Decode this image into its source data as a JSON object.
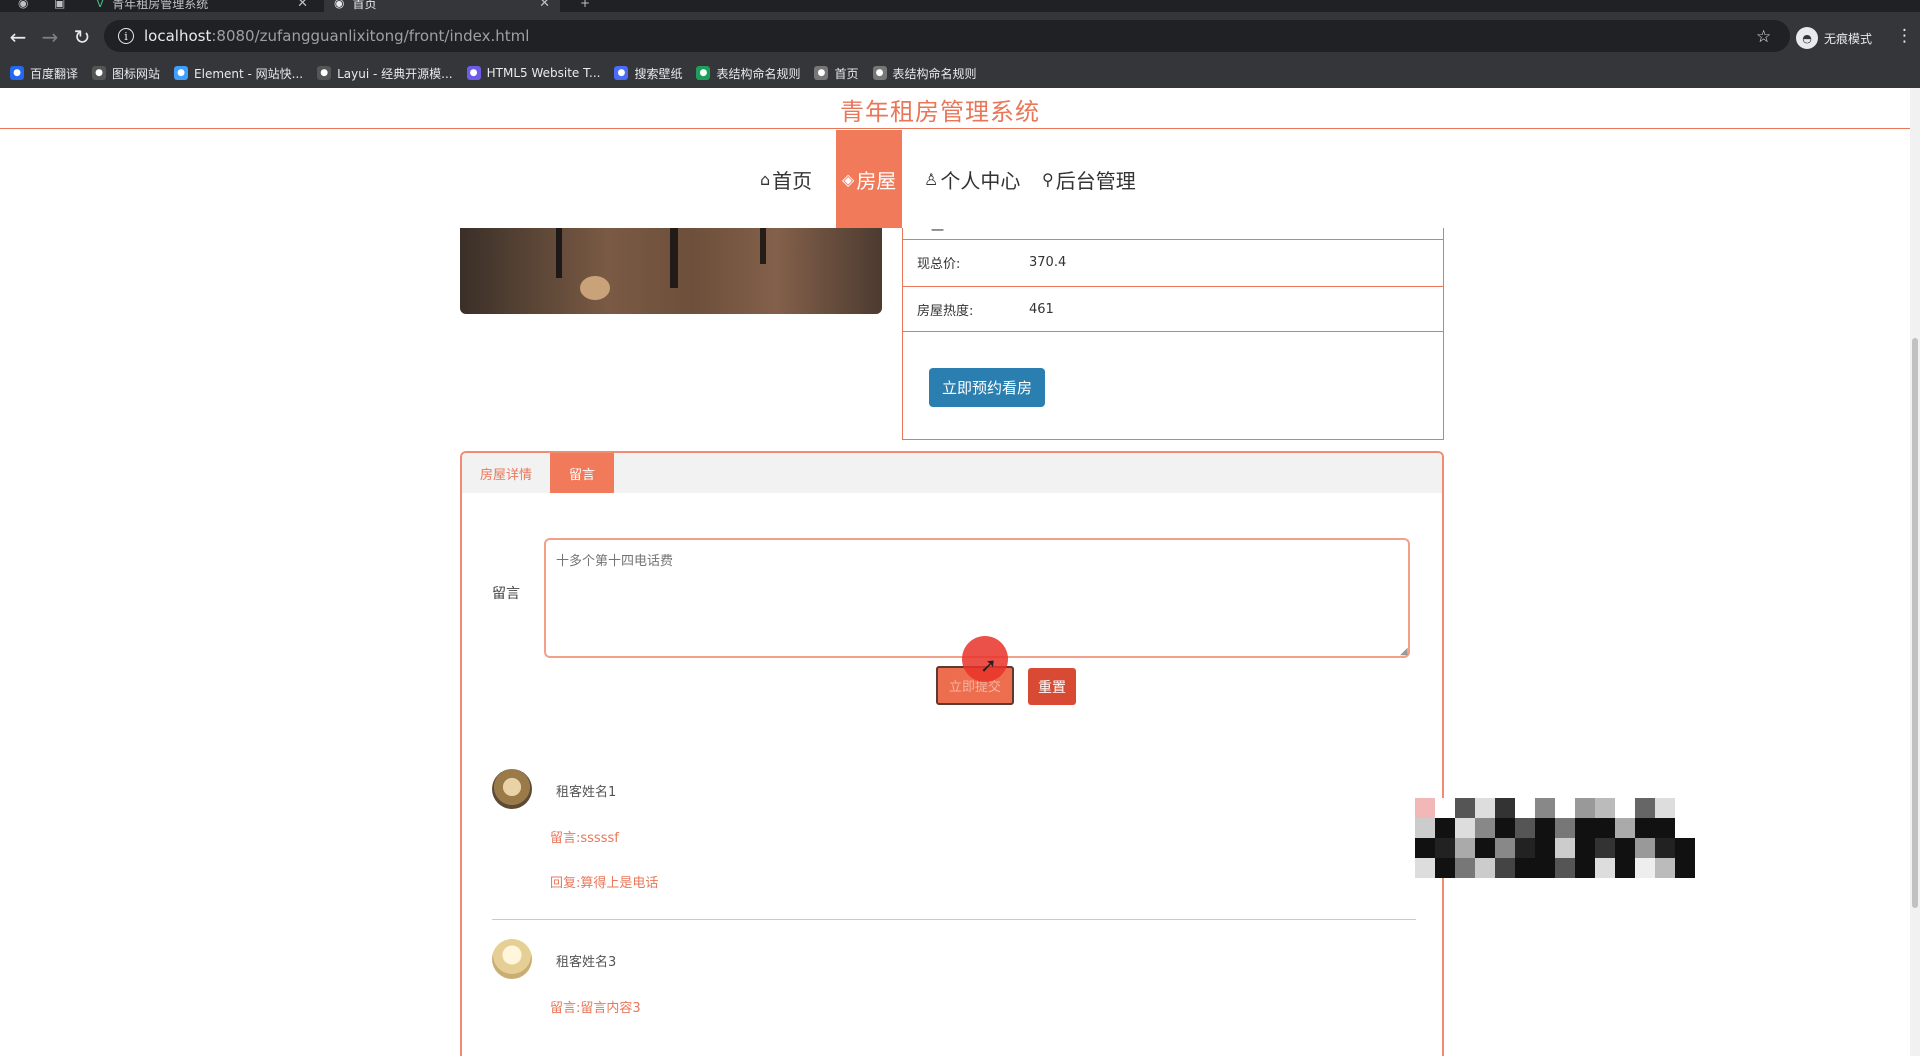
{
  "browser": {
    "tabs": [
      {
        "label": "青年租房管理系统",
        "active": false
      },
      {
        "label": "首页",
        "active": true
      }
    ],
    "new_tab": "+",
    "url_host": "localhost",
    "url_path": ":8080/zufangguanlixitong/front/index.html",
    "incognito_label": "无痕模式",
    "bookmarks": [
      {
        "label": "百度翻译",
        "icon": "translate-icon",
        "color": "#2468f2"
      },
      {
        "label": "图标网站",
        "icon": "flag-icon",
        "color": "#555555"
      },
      {
        "label": "Element - 网站快...",
        "icon": "element-icon",
        "color": "#409eff"
      },
      {
        "label": "Layui - 经典开源模...",
        "icon": "layui-icon",
        "color": "#555555"
      },
      {
        "label": "HTML5 Website T...",
        "icon": "html5-icon",
        "color": "#6c5ce7"
      },
      {
        "label": "搜索壁纸",
        "icon": "wallpaper-icon",
        "color": "#4a6cf7"
      },
      {
        "label": "表结构命名规则",
        "icon": "sheet-icon",
        "color": "#1e9e5a"
      },
      {
        "label": "首页",
        "icon": "globe-icon",
        "color": "#777777"
      },
      {
        "label": "表结构命名规则",
        "icon": "globe-icon",
        "color": "#777777"
      }
    ]
  },
  "site": {
    "title": "青年租房管理系统",
    "accent": "#f07a5a",
    "nav": [
      {
        "label": "首页",
        "icon": "home-icon",
        "glyph": "⌂",
        "active": false
      },
      {
        "label": "房屋",
        "icon": "house-stack-icon",
        "glyph": "◈",
        "active": true
      },
      {
        "label": "个人中心",
        "icon": "user-icon",
        "glyph": "♙",
        "active": false
      },
      {
        "label": "后台管理",
        "icon": "link-icon",
        "glyph": "🔗",
        "active": false
      }
    ]
  },
  "house": {
    "partial_row_value": "一",
    "rows": [
      {
        "label": "现总价:",
        "value": "370.4"
      },
      {
        "label": "房屋热度:",
        "value": "461"
      }
    ],
    "book_button": "立即预约看房"
  },
  "panel": {
    "tabs": [
      {
        "label": "房屋详情",
        "active": false
      },
      {
        "label": "留言",
        "active": true
      }
    ],
    "message_label": "留言",
    "message_placeholder": "十多个第十四电话费",
    "submit_button": "立即提交",
    "reset_button": "重置",
    "comments": [
      {
        "name": "租客姓名1",
        "message": "留言:sssssf",
        "reply": "回复:算得上是电话"
      },
      {
        "name": "租客姓名3",
        "message": "留言:留言内容3",
        "reply": ""
      }
    ]
  }
}
